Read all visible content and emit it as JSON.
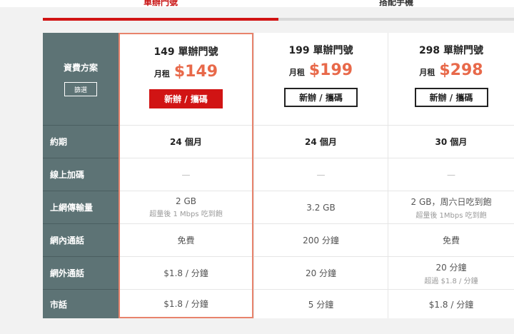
{
  "tabs": [
    {
      "label": "單辦門號",
      "active": true
    },
    {
      "label": "搭配手機",
      "active": false
    }
  ],
  "header": {
    "title": "資費方案",
    "filter_label": "篩選"
  },
  "row_labels": [
    "約期",
    "線上加碼",
    "上網傳輸量",
    "網內通話",
    "網外通話",
    "市話"
  ],
  "plans": [
    {
      "name": "149 單辦門號",
      "price_prefix": "月租",
      "price": "$149",
      "button": "新辦 / 攜碼",
      "cells": [
        {
          "main": "24 個月",
          "sub": ""
        },
        {
          "main": "—",
          "sub": ""
        },
        {
          "main": "2 GB",
          "sub": "超量後 1 Mbps 吃到飽"
        },
        {
          "main": "免費",
          "sub": ""
        },
        {
          "main": "$1.8 / 分鐘",
          "sub": ""
        },
        {
          "main": "$1.8 / 分鐘",
          "sub": ""
        }
      ]
    },
    {
      "name": "199 單辦門號",
      "price_prefix": "月租",
      "price": "$199",
      "button": "新辦 / 攜碼",
      "cells": [
        {
          "main": "24 個月",
          "sub": ""
        },
        {
          "main": "—",
          "sub": ""
        },
        {
          "main": "3.2 GB",
          "sub": ""
        },
        {
          "main": "200 分鐘",
          "sub": ""
        },
        {
          "main": "20 分鐘",
          "sub": ""
        },
        {
          "main": "5 分鐘",
          "sub": ""
        }
      ]
    },
    {
      "name": "298 單辦門號",
      "price_prefix": "月租",
      "price": "$298",
      "button": "新辦 / 攜碼",
      "cells": [
        {
          "main": "30 個月",
          "sub": ""
        },
        {
          "main": "—",
          "sub": ""
        },
        {
          "main": "2 GB，周六日吃到飽",
          "sub": "超量後 1Mbps 吃到飽"
        },
        {
          "main": "免費",
          "sub": ""
        },
        {
          "main": "20 分鐘",
          "sub": "超過 $1.8 / 分鐘"
        },
        {
          "main": "$1.8 / 分鐘",
          "sub": ""
        }
      ]
    }
  ],
  "colors": {
    "accent": "#d11414",
    "price": "#e8694a",
    "rowhead": "#5d7375",
    "highlight_border": "#e8836c"
  }
}
